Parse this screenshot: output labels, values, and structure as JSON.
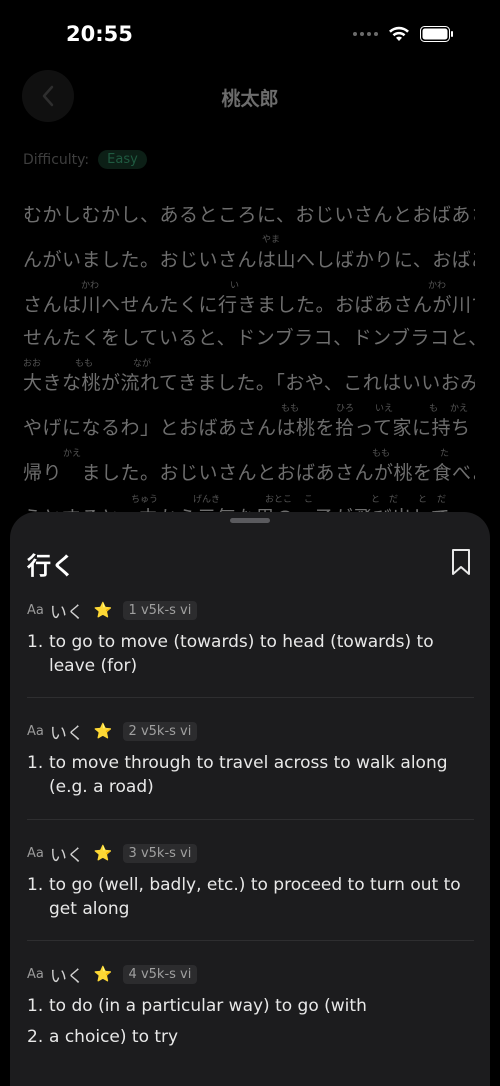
{
  "status": {
    "time": "20:55"
  },
  "nav": {
    "title": "桃太郎"
  },
  "difficulty": {
    "label": "Difficulty:",
    "value": "Easy"
  },
  "story": {
    "lines": [
      "むかしむかし、あるところに、おじいさんとおばあさ",
      "んがいました。おじいさんは山へしばかりに、おばあ",
      "さんは川へせんたくに行きました。おばあさんが川で",
      "せんたくをしていると、ドンブラコ、ドンブラコと、",
      "大きな桃が流れてきました。「おや、これはいいおみ",
      "やげになるわ」とおばあさんは桃を拾って家に持ち",
      "帰り　ました。おじいさんとおばあさんが桃を食べよ",
      "うとすると、中から元気な男の　子が飛び出して"
    ],
    "ruby": [
      "やま",
      "い",
      "かわ",
      "かわ",
      "おお",
      "もも",
      "なが",
      "もも",
      "ひろ",
      "いえ",
      "も",
      "かえ",
      "かえ",
      "もも",
      "た",
      "ちゅう",
      "げんき",
      "おとこ",
      "こ",
      "と",
      "だ",
      "と",
      "だ"
    ]
  },
  "sheet": {
    "title": "行く",
    "entries": [
      {
        "aa": "Aa",
        "reading": "いく",
        "star": "⭐",
        "tag": "1 v5k-s vi",
        "senses": [
          {
            "num": "1.",
            "text": "to go to move (towards) to head (towards) to leave (for)"
          }
        ]
      },
      {
        "aa": "Aa",
        "reading": "いく",
        "star": "⭐",
        "tag": "2 v5k-s vi",
        "senses": [
          {
            "num": "1.",
            "text": "to move through to travel across to walk along (e.g. a road)"
          }
        ]
      },
      {
        "aa": "Aa",
        "reading": "いく",
        "star": "⭐",
        "tag": "3 v5k-s vi",
        "senses": [
          {
            "num": "1.",
            "text": "to go (well, badly, etc.) to proceed to turn out to get along"
          }
        ]
      },
      {
        "aa": "Aa",
        "reading": "いく",
        "star": "⭐",
        "tag": "4 v5k-s vi",
        "senses": [
          {
            "num": "1.",
            "text": "to do (in a particular way) to go (with"
          },
          {
            "num": "2.",
            "text": " a choice) to try"
          }
        ]
      }
    ]
  }
}
